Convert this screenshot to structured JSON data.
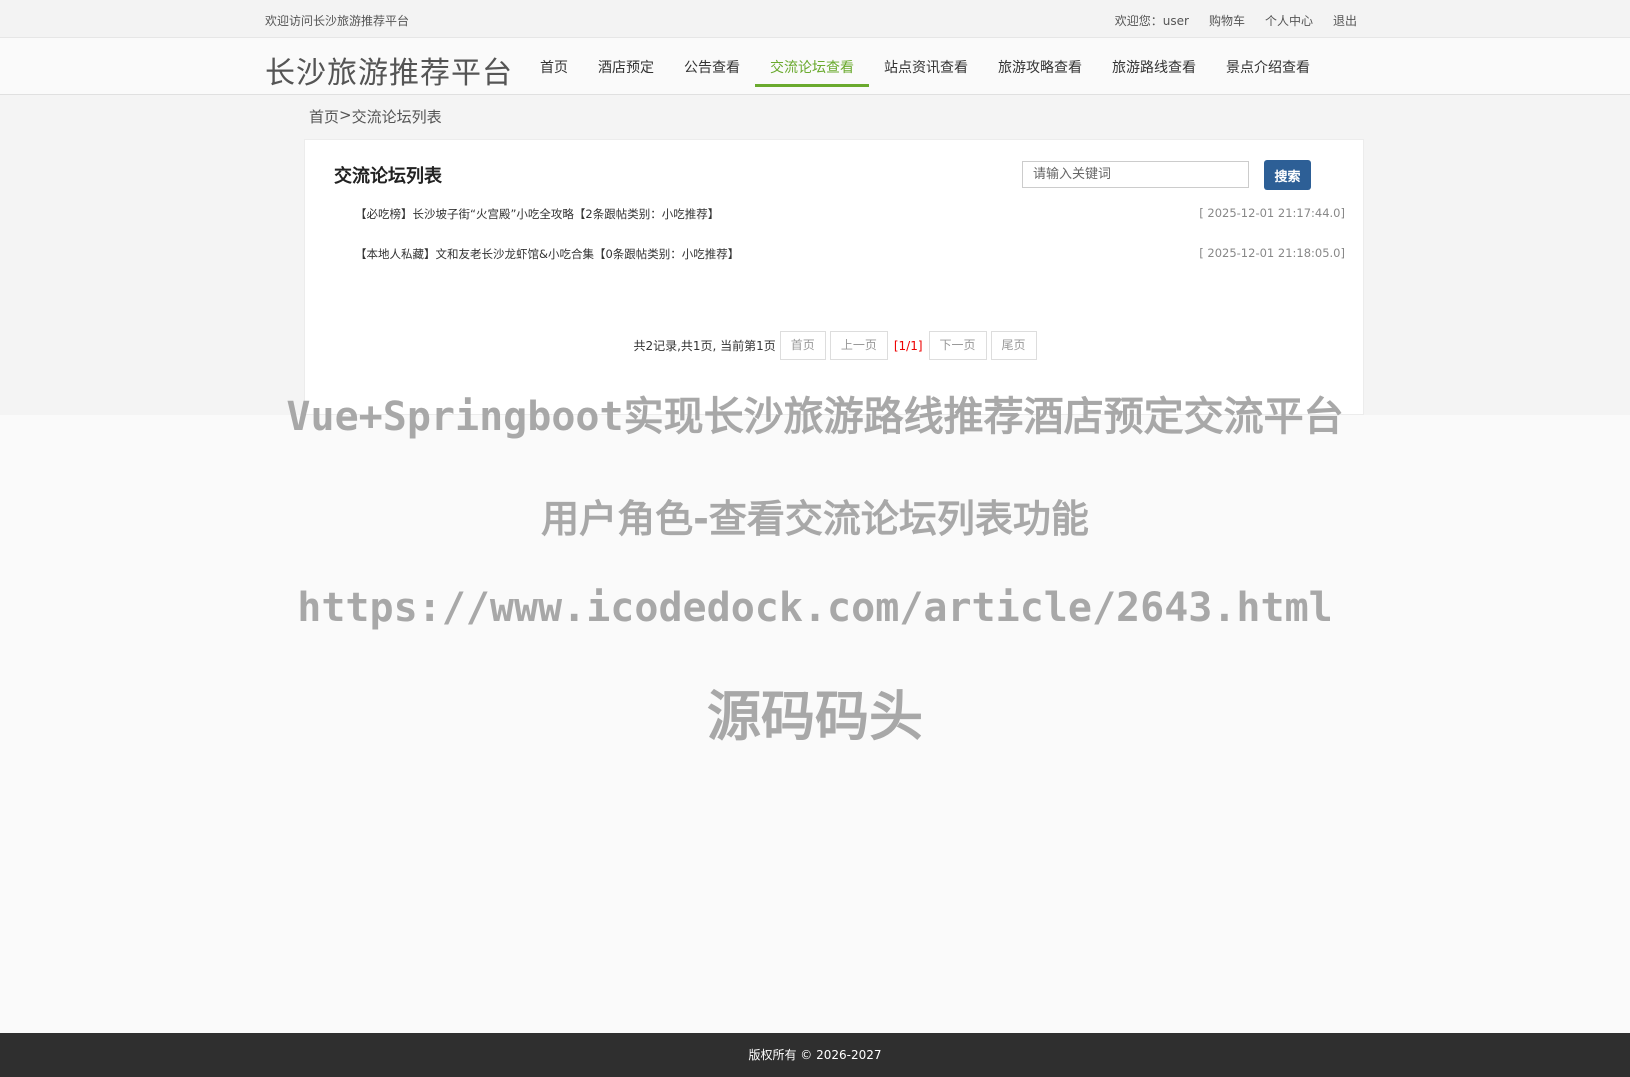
{
  "topbar": {
    "welcome": "欢迎访问长沙旅游推荐平台",
    "links": [
      "欢迎您：user",
      "购物车",
      "个人中心",
      "退出"
    ]
  },
  "header": {
    "site_title": "长沙旅游推荐平台",
    "nav": [
      "首页",
      "酒店预定",
      "公告查看",
      "交流论坛查看",
      "站点资讯查看",
      "旅游攻略查看",
      "旅游路线查看",
      "景点介绍查看"
    ],
    "active_nav": "交流论坛查看",
    "accent_color": "#6aaa2e"
  },
  "breadcrumb": {
    "home": "首页",
    "separator": ">",
    "current": "交流论坛列表"
  },
  "panel": {
    "title": "交流论坛列表",
    "search_placeholder": "请输入关键词",
    "search_button": "搜索",
    "posts": [
      {
        "title": "【必吃榜】长沙坡子街“火宫殿”小吃全攻略【2条跟帖类别：小吃推荐】",
        "date": "[ 2025-12-01 21:17:44.0]"
      },
      {
        "title": "【本地人私藏】文和友老长沙龙虾馆&小吃合集【0条跟帖类别：小吃推荐】",
        "date": "[ 2025-12-01 21:18:05.0]"
      }
    ]
  },
  "pager": {
    "summary": "共2记录,共1页, 当前第1页",
    "first": "首页",
    "prev": "上一页",
    "current": "[1/1]",
    "next": "下一页",
    "last": "尾页"
  },
  "watermark": {
    "line1": "Vue+Springboot实现长沙旅游路线推荐酒店预定交流平台",
    "line2": "用户角色-查看交流论坛列表功能",
    "line3": "https://www.icodedock.com/article/2643.html",
    "line4": "源码码头"
  },
  "footer": {
    "copyright": "版权所有 © 2026-2027"
  }
}
